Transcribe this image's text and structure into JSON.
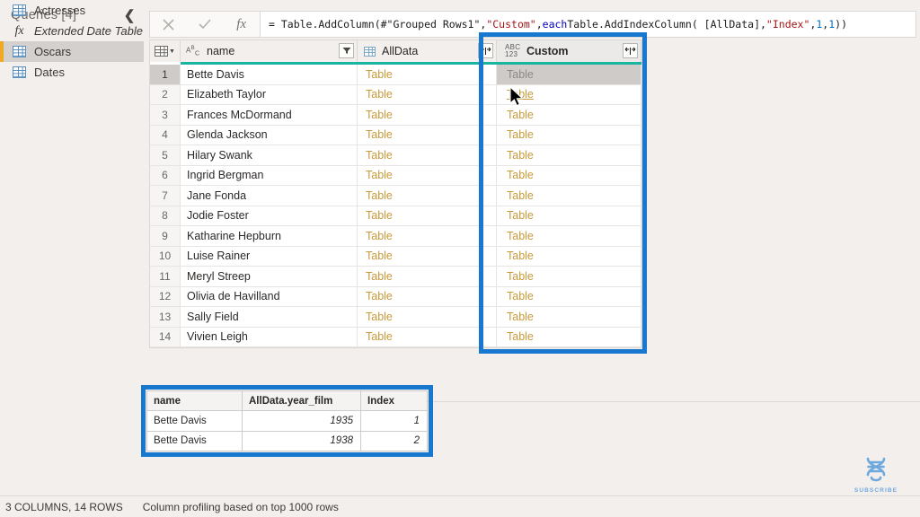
{
  "queries_pane": {
    "title": "Queries [4]",
    "collapse_icon": "chevron-left-icon",
    "items": [
      {
        "label": "Actresses",
        "icon": "table-icon",
        "selected": false
      },
      {
        "label": "Extended Date Table",
        "icon": "fx-icon",
        "selected": false
      },
      {
        "label": "Oscars",
        "icon": "table-icon",
        "selected": true
      },
      {
        "label": "Dates",
        "icon": "table-icon",
        "selected": false
      }
    ]
  },
  "formula_bar": {
    "cancel_icon": "close-icon",
    "accept_icon": "check-icon",
    "fx_icon": "fx-icon",
    "formula_plain": "= Table.AddColumn(#\"Grouped Rows1\", \"Custom\", each Table.AddIndexColumn( [AllData], \"Index\", 1, 1 ))",
    "tokens": {
      "p1": "= Table.AddColumn(#\"Grouped Rows1\", ",
      "s1": "\"Custom\"",
      "p2": ", ",
      "k1": "each",
      "p3": " Table.AddIndexColumn( [AllData], ",
      "s2": "\"Index\"",
      "p4": ", ",
      "n1": "1",
      "p5": ", ",
      "n2": "1",
      "p6": " ))"
    }
  },
  "grid": {
    "columns": [
      {
        "label": "name",
        "type_icon": "abc-text-icon",
        "button_icon": "filter-dropdown-icon"
      },
      {
        "label": "AllData",
        "type_icon": "table-type-icon",
        "button_icon": "expand-columns-icon"
      },
      {
        "label": "Custom",
        "type_icon": "abc123-any-icon",
        "button_icon": "expand-columns-icon"
      }
    ],
    "rows": [
      {
        "n": "1",
        "name": "Bette Davis",
        "alldata": "Table",
        "custom": "Table"
      },
      {
        "n": "2",
        "name": "Elizabeth Taylor",
        "alldata": "Table",
        "custom": "Table"
      },
      {
        "n": "3",
        "name": "Frances McDormand",
        "alldata": "Table",
        "custom": "Table"
      },
      {
        "n": "4",
        "name": "Glenda Jackson",
        "alldata": "Table",
        "custom": "Table"
      },
      {
        "n": "5",
        "name": "Hilary Swank",
        "alldata": "Table",
        "custom": "Table"
      },
      {
        "n": "6",
        "name": "Ingrid Bergman",
        "alldata": "Table",
        "custom": "Table"
      },
      {
        "n": "7",
        "name": "Jane Fonda",
        "alldata": "Table",
        "custom": "Table"
      },
      {
        "n": "8",
        "name": "Jodie Foster",
        "alldata": "Table",
        "custom": "Table"
      },
      {
        "n": "9",
        "name": "Katharine Hepburn",
        "alldata": "Table",
        "custom": "Table"
      },
      {
        "n": "10",
        "name": "Luise Rainer",
        "alldata": "Table",
        "custom": "Table"
      },
      {
        "n": "11",
        "name": "Meryl Streep",
        "alldata": "Table",
        "custom": "Table"
      },
      {
        "n": "12",
        "name": "Olivia de Havilland",
        "alldata": "Table",
        "custom": "Table"
      },
      {
        "n": "13",
        "name": "Sally Field",
        "alldata": "Table",
        "custom": "Table"
      },
      {
        "n": "14",
        "name": "Vivien Leigh",
        "alldata": "Table",
        "custom": "Table"
      }
    ]
  },
  "preview_table": {
    "headers": [
      "name",
      "AllData.year_film",
      "Index"
    ],
    "rows": [
      [
        "Bette Davis",
        "1935",
        "1"
      ],
      [
        "Bette Davis",
        "1938",
        "2"
      ]
    ]
  },
  "status_bar": {
    "columns_rows": "3 COLUMNS, 14 ROWS",
    "profiling": "Column profiling based on top 1000 rows"
  },
  "watermark": {
    "label": "SUBSCRIBE",
    "icon": "dna-helix-icon"
  },
  "colors": {
    "accent_teal": "#19b5a0",
    "annotation_blue": "#1878d0",
    "selection_orange": "#eeaa22",
    "table_link": "#c79a3a",
    "background": "#f2efed"
  }
}
